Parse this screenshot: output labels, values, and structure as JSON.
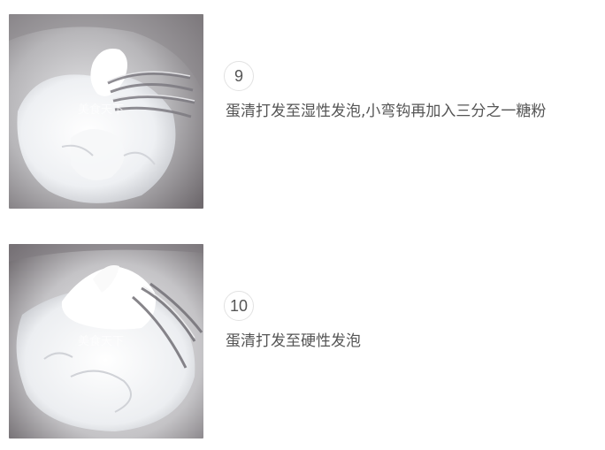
{
  "steps": [
    {
      "number": "9",
      "text": "蛋清打发至湿性发泡,小弯钩再加入三分之一糖粉",
      "photo": {
        "subject": "whisk-with-soft-peak-meringue",
        "watermark": "美食天下"
      }
    },
    {
      "number": "10",
      "text": "蛋清打发至硬性发泡",
      "photo": {
        "subject": "whisk-with-stiff-peak-meringue",
        "watermark": "美食天下"
      }
    }
  ],
  "colors": {
    "text": "#555555",
    "circle_border": "#e2e2e2",
    "background": "#ffffff"
  }
}
